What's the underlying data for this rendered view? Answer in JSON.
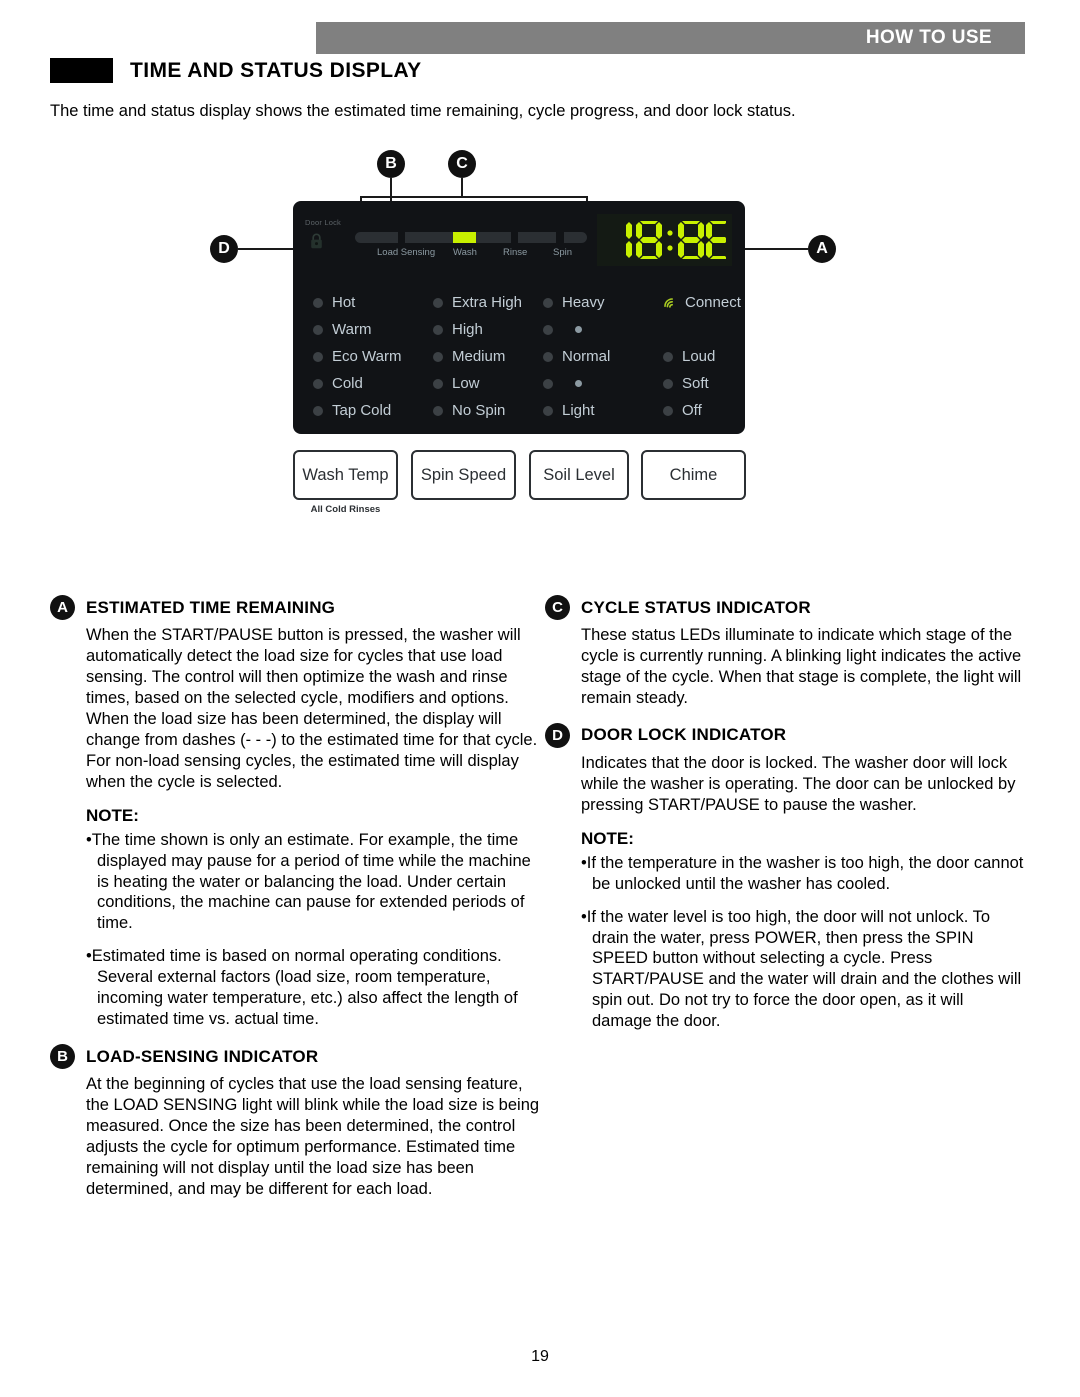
{
  "header": {
    "section_tag": "HOW TO USE",
    "title": "TIME AND STATUS DISPLAY"
  },
  "intro": "The time and status display shows the estimated time remaining, cycle progress, and door lock status.",
  "diagram": {
    "callouts": {
      "a": "A",
      "b": "B",
      "c": "C",
      "d": "D"
    },
    "door_lock_label": "Door Lock",
    "lock_icon": "padlock-icon",
    "display_value": "18:88",
    "stages": [
      "Load Sensing",
      "Wash",
      "Rinse",
      "Spin"
    ],
    "active_stage": "Wash",
    "wash_temp_leds": [
      "Hot",
      "Warm",
      "Eco Warm",
      "Cold",
      "Tap Cold"
    ],
    "spin_speed_leds": [
      "Extra High",
      "High",
      "Medium",
      "Low",
      "No Spin"
    ],
    "soil_level_leds": [
      "Heavy",
      "",
      "Normal",
      "",
      "Light"
    ],
    "chime_leds": [
      "Connect",
      "",
      "Loud",
      "Soft",
      "Off"
    ],
    "connect_icon": "wifi-icon",
    "buttons": [
      "Wash Temp",
      "Spin Speed",
      "Soil Level",
      "Chime"
    ],
    "button_sublabel": "All Cold Rinses"
  },
  "sections": {
    "a": {
      "letter": "A",
      "title": "ESTIMATED TIME REMAINING",
      "body": "When the START/PAUSE button is pressed, the washer will automatically detect the load size for cycles that use load sensing. The control will then optimize the wash and rinse times, based on the selected cycle, modifiers and options. When the load size has been determined, the display will change from dashes (- - -) to the estimated time for that cycle. For non-load sensing cycles, the estimated time will display  when the cycle is selected.",
      "note_label": "NOTE:",
      "notes": [
        "The time shown is only an estimate. For example, the time displayed may pause for a period of time while the machine is heating the water or balancing the load. Under certain conditions, the machine can pause for extended periods of time.",
        "Estimated time is based on normal operating conditions. Several external factors (load size, room temperature, incoming water temperature, etc.) also affect the length of estimated time vs. actual time."
      ]
    },
    "b": {
      "letter": "B",
      "title": "LOAD-SENSING INDICATOR",
      "body": "At the beginning of cycles that use the load sensing feature, the LOAD SENSING light will blink while the load size is being measured. Once the size has been determined, the control adjusts the cycle for optimum performance. Estimated time remaining will not display until the load size has been determined, and may be different for each load."
    },
    "c": {
      "letter": "C",
      "title": "CYCLE STATUS INDICATOR",
      "body": "These status LEDs illuminate to indicate which stage of the cycle is currently running. A blinking light indicates the active stage of the cycle. When that stage is complete, the light will remain steady."
    },
    "d": {
      "letter": "D",
      "title": "DOOR LOCK INDICATOR",
      "body": "Indicates that the door is locked. The washer door will lock while the washer is operating. The door can be unlocked by pressing START/PAUSE to pause the washer.",
      "note_label": "NOTE:",
      "notes": [
        "If the temperature in the washer is too high, the door cannot be unlocked until the washer has cooled.",
        "If the water level is too high, the door will not unlock. To drain the water, press POWER, then press the SPIN SPEED button without selecting a cycle. Press START/PAUSE and the water will drain and the clothes will spin out. Do not try to force the door open, as it will damage the door."
      ]
    }
  },
  "page_number": "19",
  "colors": {
    "header_bar": "#808080",
    "panel": "#111316",
    "led_green": "#c8f000",
    "led_text": "#c3ced6"
  }
}
